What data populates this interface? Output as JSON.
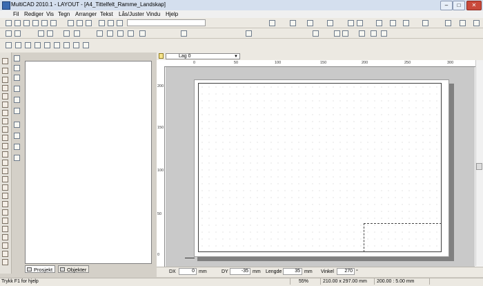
{
  "window": {
    "title": "MultiCAD 2010.1 - LAYOUT - [A4_Tittelfelt_Ramme_Landskap]",
    "minimize": "–",
    "maximize": "□",
    "close": "✕"
  },
  "menu": {
    "items": [
      "Fil",
      "Rediger",
      "Vis",
      "Tegn",
      "Arranger",
      "Tekst",
      "Lås/Juster",
      "Vindu",
      "Hjelp"
    ]
  },
  "layer": {
    "selected": "Lag 0"
  },
  "ruler": {
    "h": [
      "0",
      "50",
      "100",
      "150",
      "200",
      "250",
      "300"
    ],
    "v": [
      "200",
      "150",
      "100",
      "50",
      "0"
    ]
  },
  "panel_tabs": {
    "prosjekt": "Prosjekt",
    "objekter": "Objekter"
  },
  "coords": {
    "dx_label": "DX",
    "dx_value": "0",
    "dx_unit": "mm",
    "dy_label": "DY",
    "dy_value": "-35",
    "dy_unit": "mm",
    "lengde_label": "Lengde",
    "lengde_value": "35",
    "lengde_unit": "mm",
    "vinkel_label": "Vinkel",
    "vinkel_value": "270",
    "vinkel_unit": "°"
  },
  "status": {
    "hint": "Trykk F1 for hjelp",
    "zoom": "55%",
    "paper": "210.00 x 297.00 mm",
    "scale": "200.00 : 5.00 mm"
  },
  "icons": {
    "toolbar1": "file-and-edit-icons",
    "toolbar2": "draw-tools-icons",
    "toolbar3": "3d-tools-icons",
    "left_strip": "tool-palette-icons"
  },
  "colors": {
    "titlebar": "#d4dfee",
    "chrome": "#ece9e2",
    "canvas": "#c9c9c9",
    "close": "#c94a3b"
  }
}
